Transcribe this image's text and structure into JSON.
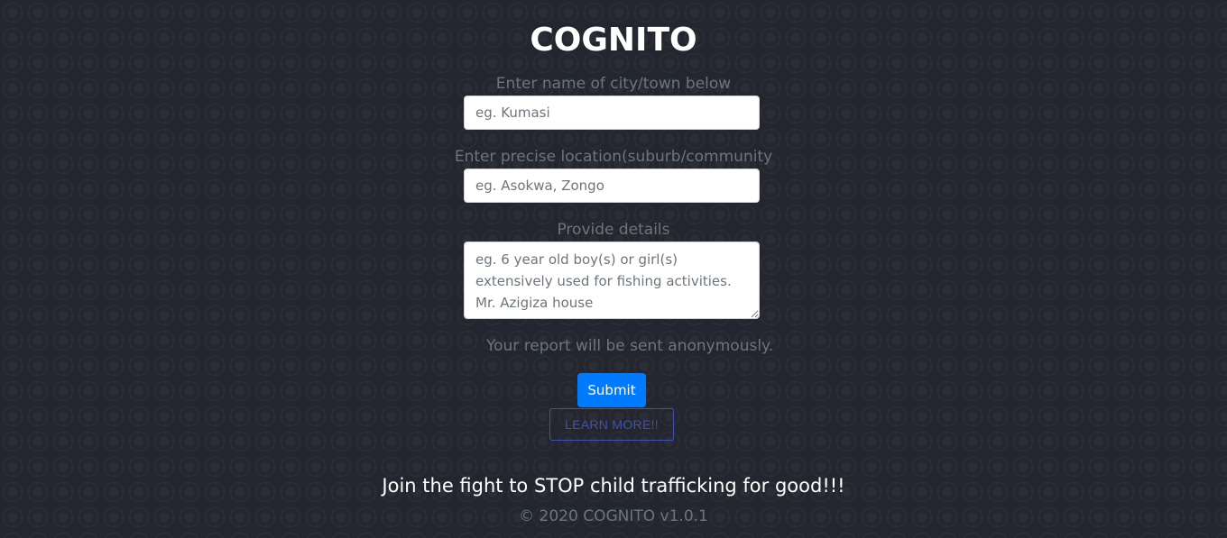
{
  "app": {
    "title": "COGNITO"
  },
  "form": {
    "city": {
      "label": "Enter name of city/town below",
      "placeholder": "eg. Kumasi",
      "value": ""
    },
    "location": {
      "label": "Enter precise location(suburb/community",
      "placeholder": "eg. Asokwa, Zongo",
      "value": ""
    },
    "details": {
      "label": "Provide details",
      "placeholder": "eg. 6 year old boy(s) or girl(s) extensively used for fishing activities. Mr. Azigiza house",
      "value": ""
    },
    "anonymous_note": "Your report will be sent anonymously.",
    "submit_label": "Submit",
    "learn_more_label": "LEARN MORE!!"
  },
  "footer": {
    "tagline": "Join the fight to STOP child trafficking for good!!!",
    "copyright": "© 2020 COGNITO v1.0.1"
  },
  "colors": {
    "background": "#23262f",
    "title": "#ffffff",
    "muted_text": "#6c757d",
    "primary_button": "#007bff",
    "outline_button": "#3f51b5"
  }
}
